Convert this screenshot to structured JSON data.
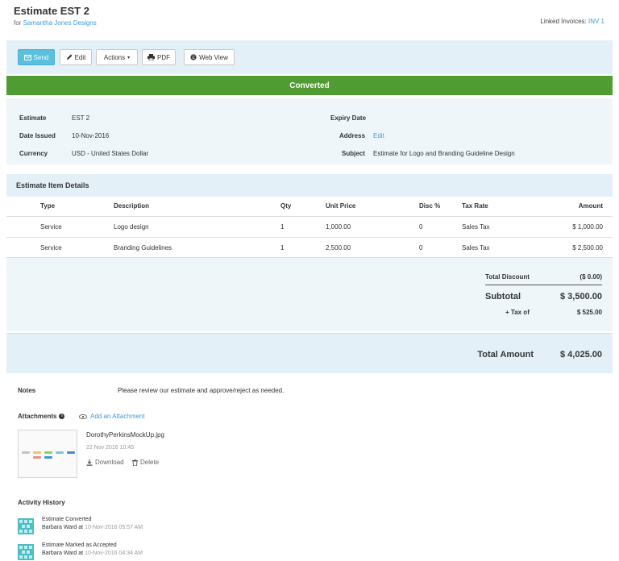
{
  "header": {
    "title": "Estimate EST 2",
    "for_label": "for",
    "client": "Samantha Jones Designs",
    "linked_label": "Linked Invoices:",
    "linked_value": "INV 1"
  },
  "toolbar": {
    "send": "Send",
    "edit": "Edit",
    "actions": "Actions",
    "pdf": "PDF",
    "webview": "Web View"
  },
  "status": {
    "label": "Converted",
    "color": "#4e9c32"
  },
  "info": {
    "estimate_label": "Estimate",
    "estimate_value": "EST 2",
    "date_label": "Date Issued",
    "date_value": "10-Nov-2016",
    "currency_label": "Currency",
    "currency_value": "USD - United States Dollar",
    "expiry_label": "Expiry Date",
    "expiry_value": "",
    "address_label": "Address",
    "address_value": "Edit",
    "subject_label": "Subject",
    "subject_value": "Estimate for Logo and Branding Guideline Design"
  },
  "items": {
    "title": "Estimate Item Details",
    "columns": [
      "Type",
      "Description",
      "Qty",
      "Unit Price",
      "Disc %",
      "Tax Rate",
      "Amount"
    ],
    "rows": [
      [
        "Service",
        "Logo design",
        "1",
        "1,000.00",
        "0",
        "Sales Tax",
        "$ 1,000.00"
      ],
      [
        "Service",
        "Branding Guidelines",
        "1",
        "2,500.00",
        "0",
        "Sales Tax",
        "$ 2,500.00"
      ]
    ]
  },
  "totals": {
    "discount_label": "Total Discount",
    "discount_value": "($ 0.00)",
    "subtotal_label": "Subtotal",
    "subtotal_value": "$ 3,500.00",
    "tax_label": "+ Tax of",
    "tax_value": "$ 525.00",
    "total_label": "Total Amount",
    "total_value": "$ 4,025.00"
  },
  "notes": {
    "label": "Notes",
    "text": "Please review our estimate and approve/reject as needed."
  },
  "attachments": {
    "label": "Attachments",
    "add": "Add an Attachment",
    "file": {
      "name": "DorothyPerkinsMockUp.jpg",
      "date": "22 Nov 2016 10:45",
      "download": "Download",
      "delete": "Delete"
    }
  },
  "activity": {
    "label": "Activity History",
    "items": [
      {
        "title": "Estimate Converted",
        "user": "Barbara Ward at",
        "time": "10-Nov-2016 05:57 AM"
      },
      {
        "title": "Estimate Marked as Accepted",
        "user": "Barbara Ward at",
        "time": "10-Nov-2016 04:34 AM"
      }
    ]
  },
  "colors": {
    "accent": "#3d9bd8",
    "panel": "#e4f0f7",
    "panel_light": "#eef6fa",
    "send": "#5bc0de"
  }
}
